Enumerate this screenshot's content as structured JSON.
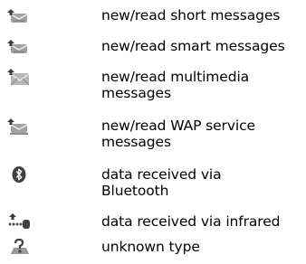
{
  "items": [
    {
      "icon": "envelope-arrow-icon",
      "label": "new/read short messages"
    },
    {
      "icon": "envelope-arrow-icon",
      "label": "new/read smart messages"
    },
    {
      "icon": "multimedia-envelope-icon",
      "label": "new/read multimedia",
      "label_line2": "messages"
    },
    {
      "icon": "wap-envelope-icon",
      "label": "new/read WAP service",
      "label_line2": "messages"
    },
    {
      "icon": "bluetooth-icon",
      "label": "data received via",
      "label_line2": "Bluetooth"
    },
    {
      "icon": "infrared-icon",
      "label": "data received via infrared"
    },
    {
      "icon": "unknown-type-icon",
      "label": "unknown type"
    }
  ]
}
